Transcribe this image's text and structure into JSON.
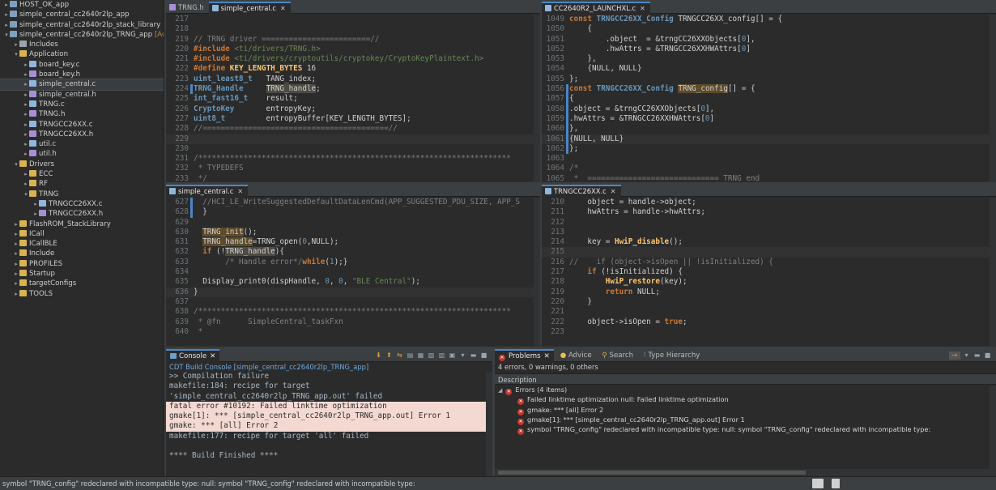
{
  "explorer": {
    "items": [
      {
        "label": "HOST_OK_app",
        "indent": 0,
        "tw": "▸",
        "icon": "proj"
      },
      {
        "label": "simple_central_cc2640r2lp_app",
        "indent": 0,
        "tw": "▸",
        "icon": "proj"
      },
      {
        "label": "simple_central_cc2640r2lp_stack_library",
        "indent": 0,
        "tw": "▸",
        "icon": "proj"
      },
      {
        "label": "simple_central_cc2640r2lp_TRNG_app",
        "indent": 0,
        "tw": "▾",
        "icon": "proj",
        "suffix": "[Active"
      },
      {
        "label": "Includes",
        "indent": 1,
        "tw": "▸",
        "icon": "inc"
      },
      {
        "label": "Application",
        "indent": 1,
        "tw": "▾",
        "icon": "fold"
      },
      {
        "label": "board_key.c",
        "indent": 2,
        "tw": "▸",
        "icon": "cfile"
      },
      {
        "label": "board_key.h",
        "indent": 2,
        "tw": "▸",
        "icon": "hfile"
      },
      {
        "label": "simple_central.c",
        "indent": 2,
        "tw": "▸",
        "icon": "cfile",
        "selected": true
      },
      {
        "label": "simple_central.h",
        "indent": 2,
        "tw": "▸",
        "icon": "hfile"
      },
      {
        "label": "TRNG.c",
        "indent": 2,
        "tw": "▸",
        "icon": "cfile"
      },
      {
        "label": "TRNG.h",
        "indent": 2,
        "tw": "▸",
        "icon": "hfile"
      },
      {
        "label": "TRNGCC26XX.c",
        "indent": 2,
        "tw": "▸",
        "icon": "cfile"
      },
      {
        "label": "TRNGCC26XX.h",
        "indent": 2,
        "tw": "▸",
        "icon": "hfile"
      },
      {
        "label": "util.c",
        "indent": 2,
        "tw": "▸",
        "icon": "cfile"
      },
      {
        "label": "util.h",
        "indent": 2,
        "tw": "▸",
        "icon": "hfile"
      },
      {
        "label": "Drivers",
        "indent": 1,
        "tw": "▾",
        "icon": "fold"
      },
      {
        "label": "ECC",
        "indent": 2,
        "tw": "▸",
        "icon": "fold"
      },
      {
        "label": "RF",
        "indent": 2,
        "tw": "▸",
        "icon": "fold"
      },
      {
        "label": "TRNG",
        "indent": 2,
        "tw": "▾",
        "icon": "fold"
      },
      {
        "label": "TRNGCC26XX.c",
        "indent": 3,
        "tw": "▸",
        "icon": "cfile"
      },
      {
        "label": "TRNGCC26XX.h",
        "indent": 3,
        "tw": "▸",
        "icon": "hfile"
      },
      {
        "label": "FlashROM_StackLibrary",
        "indent": 1,
        "tw": "▸",
        "icon": "fold"
      },
      {
        "label": "ICall",
        "indent": 1,
        "tw": "▸",
        "icon": "fold"
      },
      {
        "label": "ICallBLE",
        "indent": 1,
        "tw": "▸",
        "icon": "fold"
      },
      {
        "label": "Include",
        "indent": 1,
        "tw": "▸",
        "icon": "fold"
      },
      {
        "label": "PROFILES",
        "indent": 1,
        "tw": "▸",
        "icon": "fold"
      },
      {
        "label": "Startup",
        "indent": 1,
        "tw": "▸",
        "icon": "fold"
      },
      {
        "label": "targetConfigs",
        "indent": 1,
        "tw": "▸",
        "icon": "fold"
      },
      {
        "label": "TOOLS",
        "indent": 1,
        "tw": "▸",
        "icon": "fold"
      }
    ]
  },
  "editor_top_left": {
    "tabs": [
      "TRNG.h",
      "simple_central.c"
    ],
    "active_tab": 1,
    "lines": [
      {
        "n": "217",
        "h": ""
      },
      {
        "n": "218",
        "h": ""
      },
      {
        "n": "219",
        "h": "<span class='cm'>// TRNG driver ========================//</span>"
      },
      {
        "n": "220",
        "h": "<span class='pp'>#include</span> <span class='st'>&lt;ti/drivers/TRNG.h&gt;</span>"
      },
      {
        "n": "221",
        "h": "<span class='pp'>#include</span> <span class='st'>&lt;ti/drivers/cryptoutils/cryptokey/CryptoKeyPlaintext.h&gt;</span>"
      },
      {
        "n": "222",
        "h": "<span class='pp'>#define</span> <span class='fn'>KEY_LENGTH_BYTES</span> 16"
      },
      {
        "n": "223",
        "h": "<span class='ty'>uint_least8_t</span>   TANG_index;"
      },
      {
        "n": "224",
        "h": "<span class='ty'>TRNG_Handle</span>     <span class='hl'>TRNG_handle</span>;",
        "mark": true
      },
      {
        "n": "225",
        "h": "<span class='ty'>int_fast16_t</span>    result;"
      },
      {
        "n": "226",
        "h": "<span class='ty'>CryptoKey</span>       entropyKey;"
      },
      {
        "n": "227",
        "h": "<span class='ty'>uint8_t</span>         entropyBuffer[KEY_LENGTH_BYTES];"
      },
      {
        "n": "228",
        "h": "<span class='cm'>//=========================================//</span>"
      },
      {
        "n": "229",
        "h": "",
        "cur": true
      },
      {
        "n": "230",
        "h": ""
      },
      {
        "n": "231",
        "h": "<span class='cm'>/*********************************************************************</span>"
      },
      {
        "n": "232",
        "h": "<span class='cm'> * TYPEDEFS</span>"
      },
      {
        "n": "233",
        "h": "<span class='cm'> */</span>"
      }
    ]
  },
  "editor_top_right": {
    "tabs": [
      "CC2640R2_LAUNCHXL.c"
    ],
    "active_tab": 0,
    "lines": [
      {
        "n": "1049",
        "h": "<span class='kw'>const</span> <span class='ty'>TRNGCC26XX_Config</span> TRNGCC26XX_config[] = {"
      },
      {
        "n": "1050",
        "h": "    {"
      },
      {
        "n": "1051",
        "h": "        .object  = &amp;trngCC26XXObjects[<span class='nm'>0</span>],"
      },
      {
        "n": "1052",
        "h": "        .hwAttrs = &amp;TRNGCC26XXHWAttrs[<span class='nm'>0</span>]"
      },
      {
        "n": "1053",
        "h": "    },"
      },
      {
        "n": "1054",
        "h": "    {NULL, NULL}"
      },
      {
        "n": "1055",
        "h": "};"
      },
      {
        "n": "1056",
        "h": "<span class='kw'>const</span> <span class='ty'>TRNGCC26XX_Config</span> <span class='hlb'>TRNG_config</span>[] = {",
        "mark": true
      },
      {
        "n": "1057",
        "h": "{",
        "mark": true
      },
      {
        "n": "1058",
        "h": ".object = &amp;trngCC26XXObjects[<span class='nm'>0</span>],",
        "mark": true
      },
      {
        "n": "1059",
        "h": ".hwAttrs = &amp;TRNGCC26XXHWAttrs[<span class='nm'>0</span>]",
        "mark": true
      },
      {
        "n": "1060",
        "h": "},",
        "mark": true
      },
      {
        "n": "1061",
        "h": "{NULL, NULL}",
        "mark": true,
        "cur": true
      },
      {
        "n": "1062",
        "h": "};",
        "mark": true
      },
      {
        "n": "1063",
        "h": ""
      },
      {
        "n": "1064",
        "h": "<span class='cm'>/*</span>"
      },
      {
        "n": "1065",
        "h": "<span class='cm'> *  ============================= TRNG end</span>"
      }
    ]
  },
  "editor_bottom_left": {
    "tabs": [
      "simple_central.c"
    ],
    "active_tab": 0,
    "lines": [
      {
        "n": "627",
        "h": "  <span class='cm'>//HCI_LE_WriteSuggestedDefaultDataLenCmd(APP_SUGGESTED_PDU_SIZE, APP_S</span>",
        "mark": true
      },
      {
        "n": "628",
        "h": "  }",
        "mark": true
      },
      {
        "n": "629",
        "h": ""
      },
      {
        "n": "630",
        "h": "  <span class='hlb'>TRNG_init</span>();"
      },
      {
        "n": "631",
        "h": "  <span class='hlb'>TRNG_handle</span>=TRNG_open(<span class='nm'>0</span>,NULL);"
      },
      {
        "n": "632",
        "h": "  <span class='kw'>if</span> (!<span class='hl'>TRNG_handle</span>){"
      },
      {
        "n": "633",
        "h": "       <span class='cm'>/* Handle error*/</span><span class='kw'>while</span>(<span class='nm'>1</span>);}"
      },
      {
        "n": "634",
        "h": ""
      },
      {
        "n": "635",
        "h": "  Display_print0(dispHandle, <span class='nm'>0</span>, <span class='nm'>0</span>, <span class='st'>\"BLE Central\"</span>);"
      },
      {
        "n": "636",
        "h": "}",
        "cur": true
      },
      {
        "n": "637",
        "h": ""
      },
      {
        "n": "638",
        "h": "<span class='cm'>/*********************************************************************</span>"
      },
      {
        "n": "639",
        "h": "<span class='cm'> * @fn      SimpleCentral_taskFxn</span>"
      },
      {
        "n": "640",
        "h": "<span class='cm'> *</span>"
      }
    ]
  },
  "editor_bottom_right": {
    "tabs": [
      "TRNGCC26XX.c"
    ],
    "active_tab": 0,
    "lines": [
      {
        "n": "210",
        "h": "    object = handle-&gt;object;"
      },
      {
        "n": "211",
        "h": "    hwAttrs = handle-&gt;hwAttrs;"
      },
      {
        "n": "212",
        "h": ""
      },
      {
        "n": "213",
        "h": ""
      },
      {
        "n": "214",
        "h": "    key = <span class='fn'>HwiP_disable</span>();"
      },
      {
        "n": "215",
        "h": "",
        "cur": true
      },
      {
        "n": "216",
        "h": "<span class='cm'>//    if (object-&gt;isOpen || !isInitialized) {</span>"
      },
      {
        "n": "217",
        "h": "    <span class='kw'>if</span> (!isInitialized) {"
      },
      {
        "n": "218",
        "h": "        <span class='fn'>HwiP_restore</span>(key);"
      },
      {
        "n": "219",
        "h": "        <span class='kw'>return</span> NULL;"
      },
      {
        "n": "220",
        "h": "    }"
      },
      {
        "n": "221",
        "h": ""
      },
      {
        "n": "222",
        "h": "    object-&gt;isOpen = <span class='kw'>true</span>;"
      },
      {
        "n": "223",
        "h": ""
      }
    ]
  },
  "console": {
    "tab": "Console",
    "title": "CDT Build Console [simple_central_cc2640r2lp_TRNG_app]",
    "lines": [
      {
        "t": ">> Compilation failure",
        "err": false
      },
      {
        "t": "makefile:184: recipe for target",
        "err": false
      },
      {
        "t": "'simple_central_cc2640r2lp_TRNG_app.out' failed",
        "err": false
      },
      {
        "t": "fatal error #10192: Failed linktime optimization",
        "err": true
      },
      {
        "t": "gmake[1]: *** [simple_central_cc2640r2lp_TRNG_app.out] Error 1",
        "err": true
      },
      {
        "t": "gmake: *** [all] Error 2",
        "err": true
      },
      {
        "t": "makefile:177: recipe for target 'all' failed",
        "err": false
      },
      {
        "t": "",
        "err": false
      },
      {
        "t": "**** Build Finished ****",
        "err": false
      }
    ]
  },
  "problems": {
    "tabs": [
      "Problems",
      "Advice",
      "Search",
      "Type Hierarchy"
    ],
    "status": "4 errors, 0 warnings, 0 others",
    "column_header": "Description",
    "group_label": "Errors (4 items)",
    "rows": [
      "Failed linktime optimization null: Failed linktime optimization",
      "gmake: *** [all] Error 2",
      "gmake[1]: *** [simple_central_cc2640r2lp_TRNG_app.out] Error 1",
      "symbol \"TRNG_config\" redeclared with incompatible type: null: symbol \"TRNG_config\" redeclared with incompatible type:"
    ]
  },
  "statusbar": {
    "text": "symbol \"TRNG_config\" redeclared with incompatible type: null: symbol \"TRNG_config\" redeclared with incompatible type:"
  }
}
